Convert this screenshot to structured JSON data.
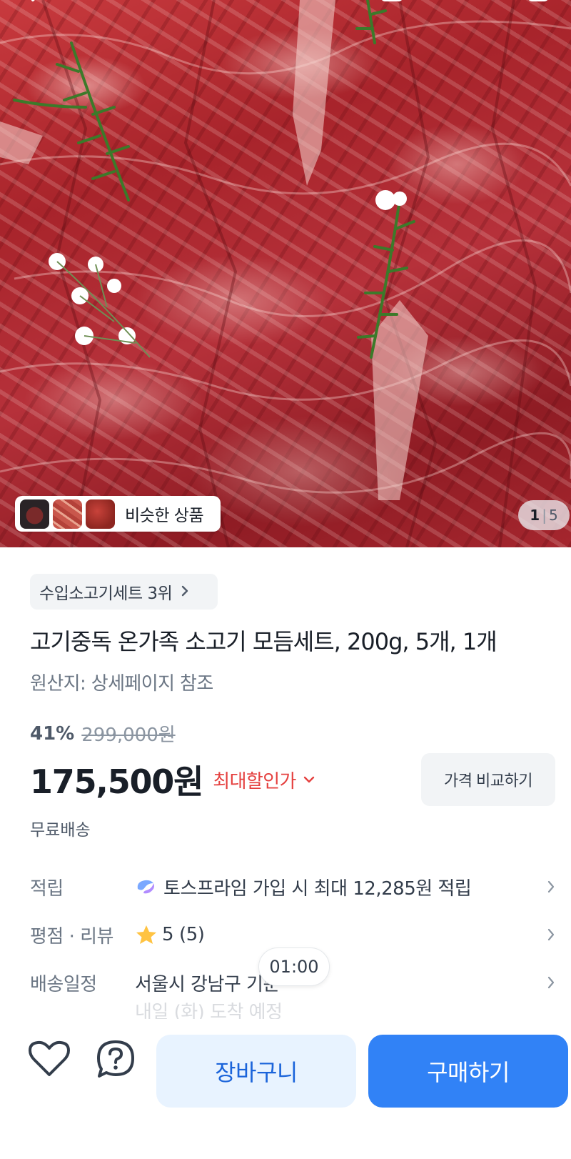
{
  "gallery": {
    "similar_label": "비슷한 상품",
    "current_page": "1",
    "total_pages": "5",
    "separator": "|"
  },
  "product": {
    "rank_label": "수입소고기세트 3위",
    "title": "고기중독 온가족 소고기 모듬세트, 200g, 5개, 1개",
    "origin": "원산지: 상세페이지 참조",
    "discount_rate": "41%",
    "original_price": "299,000원",
    "price": "175,500원",
    "max_discount_label": "최대할인가",
    "compare_button": "가격 비교하기",
    "shipping": "무료배송"
  },
  "info": {
    "point": {
      "label": "적립",
      "value": "토스프라임 가입 시 최대 12,285원 적립"
    },
    "review": {
      "label": "평점 · 리뷰",
      "rating": "5",
      "count": "(5)"
    },
    "delivery": {
      "label": "배송일정",
      "value": "서울시 강남구 기준",
      "sub": "내일 (화) 도착 예정"
    }
  },
  "time_bubble": "01:00",
  "bottom_bar": {
    "cart_button": "장바구니",
    "buy_button": "구매하기"
  },
  "icons": [
    "back-icon",
    "home-icon",
    "search-icon",
    "cart-icon",
    "chevron-right-icon",
    "chevron-down-icon",
    "toss-prime-icon",
    "star-icon",
    "heart-icon",
    "question-icon"
  ],
  "colors": {
    "accent_blue": "#3182f6",
    "cart_bg": "#e8f3ff",
    "discount_red": "#e5403f",
    "star": "#ffc342"
  }
}
